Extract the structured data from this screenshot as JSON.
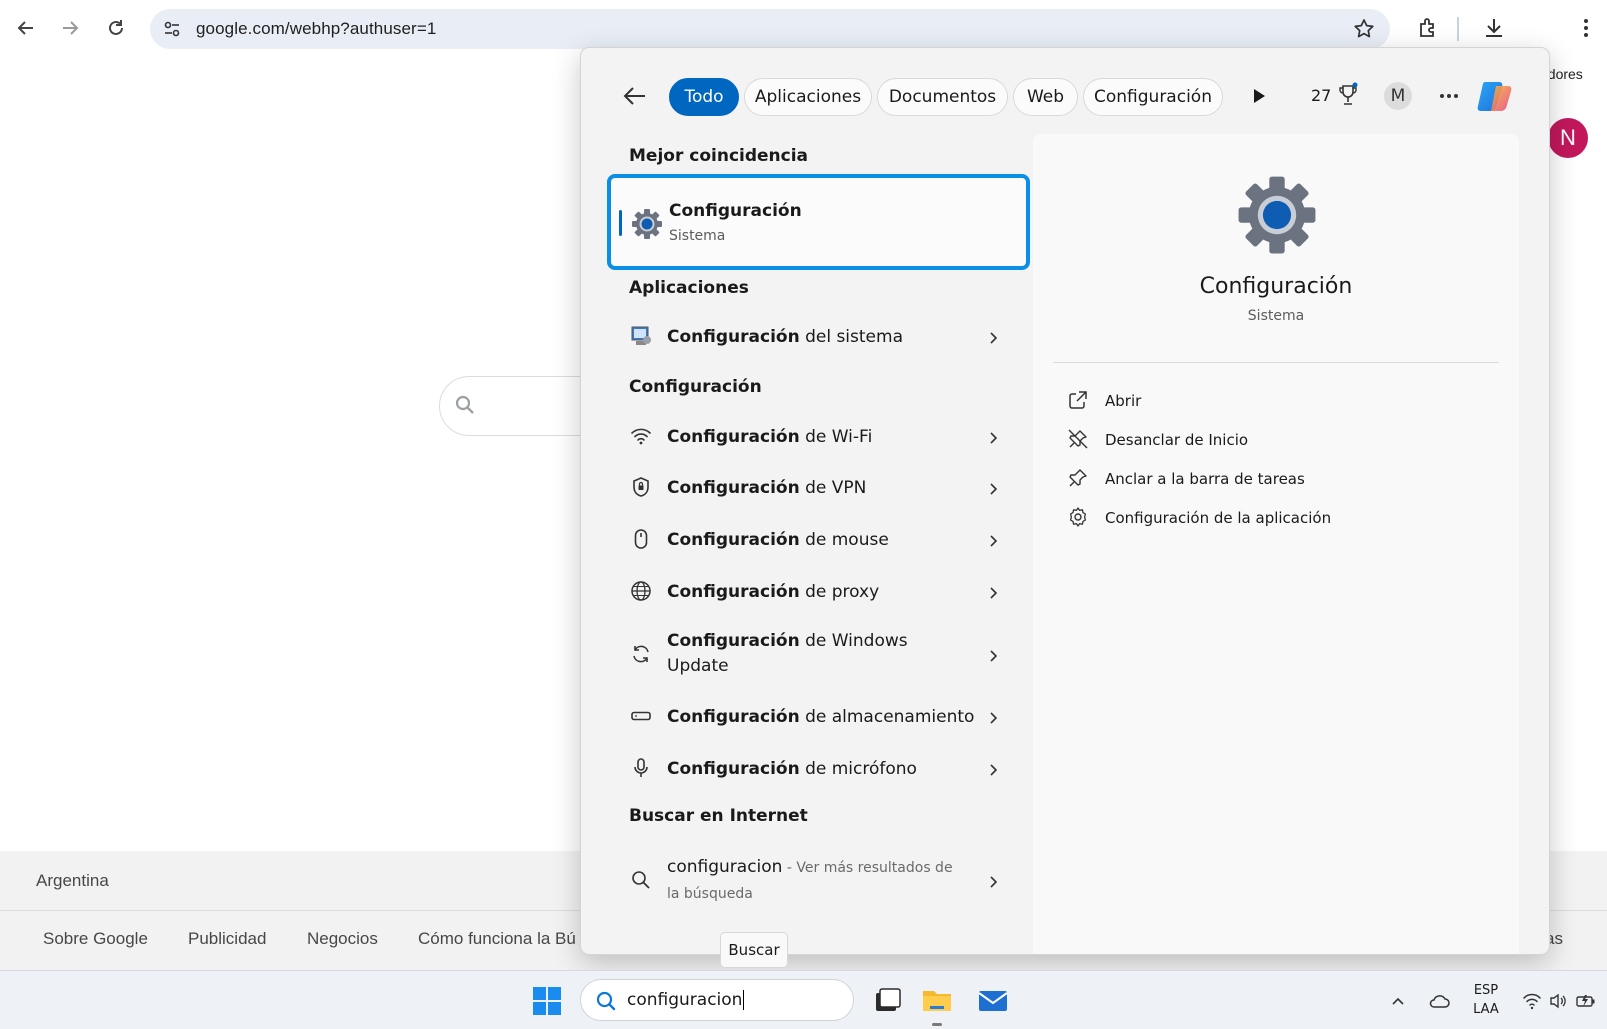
{
  "browser": {
    "url": "google.com/webhp?authuser=1",
    "icons": [
      "back-arrow-icon",
      "forward-arrow-icon",
      "reload-icon",
      "site-settings-icon",
      "bookmark-star-icon",
      "extensions-icon",
      "download-icon",
      "more-vert-icon"
    ]
  },
  "google": {
    "top_link_partial": "adores",
    "avatar_letter": "N",
    "footer": {
      "country": "Argentina",
      "links": [
        "Sobre Google",
        "Publicidad",
        "Negocios",
        "Cómo funciona la Bú"
      ],
      "right_partial": "as"
    }
  },
  "search_panel": {
    "tabs": [
      {
        "label": "Todo",
        "active": true
      },
      {
        "label": "Aplicaciones",
        "active": false
      },
      {
        "label": "Documentos",
        "active": false
      },
      {
        "label": "Web",
        "active": false
      },
      {
        "label": "Configuración",
        "active": false
      }
    ],
    "points": "27",
    "user_initial": "M",
    "sections": {
      "best_match": "Mejor coincidencia",
      "apps": "Aplicaciones",
      "settings": "Configuración",
      "web": "Buscar en Internet"
    },
    "best_match": {
      "title": "Configuración",
      "subtitle": "Sistema",
      "icon": "gear-icon"
    },
    "apps": [
      {
        "bold": "Configuración",
        "rest": " del sistema",
        "icon": "system-config-icon"
      }
    ],
    "settings": [
      {
        "bold": "Configuración",
        "rest": " de Wi-Fi",
        "icon": "wifi-icon"
      },
      {
        "bold": "Configuración",
        "rest": " de VPN",
        "icon": "shield-icon"
      },
      {
        "bold": "Configuración",
        "rest": " de mouse",
        "icon": "mouse-icon"
      },
      {
        "bold": "Configuración",
        "rest": " de proxy",
        "icon": "globe-icon"
      },
      {
        "bold": "Configuración",
        "rest": " de Windows Update",
        "icon": "sync-icon"
      },
      {
        "bold": "Configuración",
        "rest": " de almacenamiento",
        "icon": "storage-icon"
      },
      {
        "bold": "Configuración",
        "rest": " de micrófono",
        "icon": "microphone-icon"
      }
    ],
    "web": {
      "query": "configuracion",
      "hint": " - Ver más resultados de la búsqueda",
      "icon": "search-icon"
    },
    "detail": {
      "title": "Configuración",
      "subtitle": "Sistema",
      "actions": [
        {
          "label": "Abrir",
          "icon": "open-external-icon"
        },
        {
          "label": "Desanclar de Inicio",
          "icon": "unpin-icon"
        },
        {
          "label": "Anclar a la barra de tareas",
          "icon": "pin-icon"
        },
        {
          "label": "Configuración de la aplicación",
          "icon": "gear-outline-icon"
        }
      ]
    }
  },
  "tooltip": "Buscar",
  "taskbar": {
    "search_value": "configuracion",
    "lang_top": "ESP",
    "lang_bottom": "LAA",
    "accent": "#0067c0",
    "highlight": "#0a8ee6"
  }
}
